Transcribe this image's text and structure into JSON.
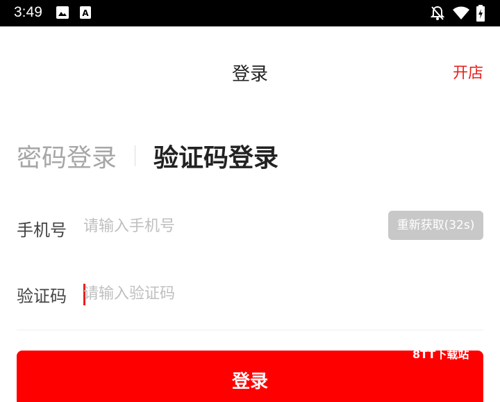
{
  "status_bar": {
    "time": "3:49",
    "icons": [
      "image-icon",
      "a-font-icon",
      "notifications-off-icon",
      "wifi-icon",
      "battery-icon"
    ]
  },
  "header": {
    "title": "登录",
    "open_store": "开店"
  },
  "tabs": {
    "password_login": "密码登录",
    "code_login": "验证码登录",
    "active": "code_login"
  },
  "form": {
    "phone": {
      "label": "手机号",
      "placeholder": "请输入手机号",
      "value": ""
    },
    "resend": "重新获取(32s)",
    "code": {
      "label": "验证码",
      "placeholder": "请输入验证码",
      "value": ""
    }
  },
  "login_button": "登录",
  "watermark": "8TT下载站",
  "colors": {
    "accent": "#e8201e",
    "button": "#ff0000",
    "disabled_button": "#c8c8c8"
  }
}
